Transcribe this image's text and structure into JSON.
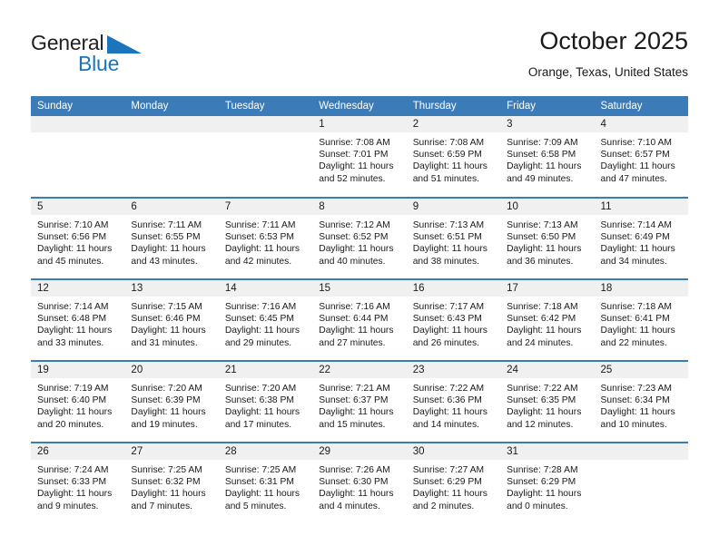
{
  "brand": {
    "name_part1": "General",
    "name_part2": "Blue",
    "logo_icon": "triangle-icon",
    "accent_color": "#1b75bc"
  },
  "header": {
    "title": "October 2025",
    "subtitle": "Orange, Texas, United States"
  },
  "colors": {
    "header_blue": "#3b7cb8",
    "daynum_band": "#f0f0f0",
    "text": "#1a1a1a"
  },
  "weekday_headers": [
    "Sunday",
    "Monday",
    "Tuesday",
    "Wednesday",
    "Thursday",
    "Friday",
    "Saturday"
  ],
  "weeks": [
    [
      {
        "day": "",
        "lines": []
      },
      {
        "day": "",
        "lines": []
      },
      {
        "day": "",
        "lines": []
      },
      {
        "day": "1",
        "lines": [
          "Sunrise: 7:08 AM",
          "Sunset: 7:01 PM",
          "Daylight: 11 hours",
          "and 52 minutes."
        ]
      },
      {
        "day": "2",
        "lines": [
          "Sunrise: 7:08 AM",
          "Sunset: 6:59 PM",
          "Daylight: 11 hours",
          "and 51 minutes."
        ]
      },
      {
        "day": "3",
        "lines": [
          "Sunrise: 7:09 AM",
          "Sunset: 6:58 PM",
          "Daylight: 11 hours",
          "and 49 minutes."
        ]
      },
      {
        "day": "4",
        "lines": [
          "Sunrise: 7:10 AM",
          "Sunset: 6:57 PM",
          "Daylight: 11 hours",
          "and 47 minutes."
        ]
      }
    ],
    [
      {
        "day": "5",
        "lines": [
          "Sunrise: 7:10 AM",
          "Sunset: 6:56 PM",
          "Daylight: 11 hours",
          "and 45 minutes."
        ]
      },
      {
        "day": "6",
        "lines": [
          "Sunrise: 7:11 AM",
          "Sunset: 6:55 PM",
          "Daylight: 11 hours",
          "and 43 minutes."
        ]
      },
      {
        "day": "7",
        "lines": [
          "Sunrise: 7:11 AM",
          "Sunset: 6:53 PM",
          "Daylight: 11 hours",
          "and 42 minutes."
        ]
      },
      {
        "day": "8",
        "lines": [
          "Sunrise: 7:12 AM",
          "Sunset: 6:52 PM",
          "Daylight: 11 hours",
          "and 40 minutes."
        ]
      },
      {
        "day": "9",
        "lines": [
          "Sunrise: 7:13 AM",
          "Sunset: 6:51 PM",
          "Daylight: 11 hours",
          "and 38 minutes."
        ]
      },
      {
        "day": "10",
        "lines": [
          "Sunrise: 7:13 AM",
          "Sunset: 6:50 PM",
          "Daylight: 11 hours",
          "and 36 minutes."
        ]
      },
      {
        "day": "11",
        "lines": [
          "Sunrise: 7:14 AM",
          "Sunset: 6:49 PM",
          "Daylight: 11 hours",
          "and 34 minutes."
        ]
      }
    ],
    [
      {
        "day": "12",
        "lines": [
          "Sunrise: 7:14 AM",
          "Sunset: 6:48 PM",
          "Daylight: 11 hours",
          "and 33 minutes."
        ]
      },
      {
        "day": "13",
        "lines": [
          "Sunrise: 7:15 AM",
          "Sunset: 6:46 PM",
          "Daylight: 11 hours",
          "and 31 minutes."
        ]
      },
      {
        "day": "14",
        "lines": [
          "Sunrise: 7:16 AM",
          "Sunset: 6:45 PM",
          "Daylight: 11 hours",
          "and 29 minutes."
        ]
      },
      {
        "day": "15",
        "lines": [
          "Sunrise: 7:16 AM",
          "Sunset: 6:44 PM",
          "Daylight: 11 hours",
          "and 27 minutes."
        ]
      },
      {
        "day": "16",
        "lines": [
          "Sunrise: 7:17 AM",
          "Sunset: 6:43 PM",
          "Daylight: 11 hours",
          "and 26 minutes."
        ]
      },
      {
        "day": "17",
        "lines": [
          "Sunrise: 7:18 AM",
          "Sunset: 6:42 PM",
          "Daylight: 11 hours",
          "and 24 minutes."
        ]
      },
      {
        "day": "18",
        "lines": [
          "Sunrise: 7:18 AM",
          "Sunset: 6:41 PM",
          "Daylight: 11 hours",
          "and 22 minutes."
        ]
      }
    ],
    [
      {
        "day": "19",
        "lines": [
          "Sunrise: 7:19 AM",
          "Sunset: 6:40 PM",
          "Daylight: 11 hours",
          "and 20 minutes."
        ]
      },
      {
        "day": "20",
        "lines": [
          "Sunrise: 7:20 AM",
          "Sunset: 6:39 PM",
          "Daylight: 11 hours",
          "and 19 minutes."
        ]
      },
      {
        "day": "21",
        "lines": [
          "Sunrise: 7:20 AM",
          "Sunset: 6:38 PM",
          "Daylight: 11 hours",
          "and 17 minutes."
        ]
      },
      {
        "day": "22",
        "lines": [
          "Sunrise: 7:21 AM",
          "Sunset: 6:37 PM",
          "Daylight: 11 hours",
          "and 15 minutes."
        ]
      },
      {
        "day": "23",
        "lines": [
          "Sunrise: 7:22 AM",
          "Sunset: 6:36 PM",
          "Daylight: 11 hours",
          "and 14 minutes."
        ]
      },
      {
        "day": "24",
        "lines": [
          "Sunrise: 7:22 AM",
          "Sunset: 6:35 PM",
          "Daylight: 11 hours",
          "and 12 minutes."
        ]
      },
      {
        "day": "25",
        "lines": [
          "Sunrise: 7:23 AM",
          "Sunset: 6:34 PM",
          "Daylight: 11 hours",
          "and 10 minutes."
        ]
      }
    ],
    [
      {
        "day": "26",
        "lines": [
          "Sunrise: 7:24 AM",
          "Sunset: 6:33 PM",
          "Daylight: 11 hours",
          "and 9 minutes."
        ]
      },
      {
        "day": "27",
        "lines": [
          "Sunrise: 7:25 AM",
          "Sunset: 6:32 PM",
          "Daylight: 11 hours",
          "and 7 minutes."
        ]
      },
      {
        "day": "28",
        "lines": [
          "Sunrise: 7:25 AM",
          "Sunset: 6:31 PM",
          "Daylight: 11 hours",
          "and 5 minutes."
        ]
      },
      {
        "day": "29",
        "lines": [
          "Sunrise: 7:26 AM",
          "Sunset: 6:30 PM",
          "Daylight: 11 hours",
          "and 4 minutes."
        ]
      },
      {
        "day": "30",
        "lines": [
          "Sunrise: 7:27 AM",
          "Sunset: 6:29 PM",
          "Daylight: 11 hours",
          "and 2 minutes."
        ]
      },
      {
        "day": "31",
        "lines": [
          "Sunrise: 7:28 AM",
          "Sunset: 6:29 PM",
          "Daylight: 11 hours",
          "and 0 minutes."
        ]
      },
      {
        "day": "",
        "lines": []
      }
    ]
  ]
}
